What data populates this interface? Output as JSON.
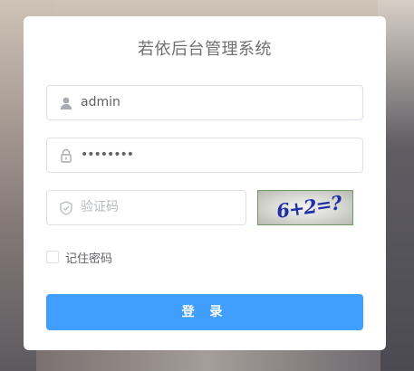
{
  "title": "若依后台管理系统",
  "login_form": {
    "username": {
      "value": "admin",
      "icon": "user-icon"
    },
    "password": {
      "value": "••••••••",
      "icon": "lock-icon"
    },
    "captcha_input": {
      "placeholder": "验证码",
      "icon": "shield-icon"
    },
    "captcha_image_text": "6+2=?",
    "remember_label": "记住密码",
    "remember_checked": false,
    "submit_label": "登 录"
  },
  "colors": {
    "primary": "#409eff",
    "title_text": "#707070",
    "border": "#dcdfe6"
  }
}
